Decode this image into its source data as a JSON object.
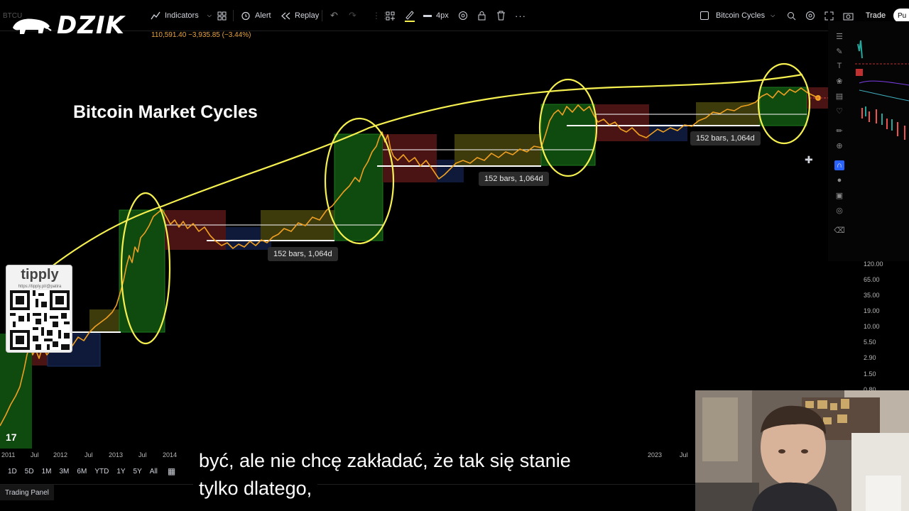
{
  "toolbar": {
    "brand": "DZIK",
    "indicators_label": "Indicators",
    "alert_label": "Alert",
    "replay_label": "Replay",
    "line_width_label": "4px",
    "layout_name": "Bitcoin Cycles",
    "trade_label": "Trade",
    "publish_label": "Pu"
  },
  "ticker": {
    "symbol": "BTCU",
    "price_info": "110,591.40  −3,935.85 (−3.44%)"
  },
  "chart": {
    "title": "Bitcoin Market Cycles",
    "measure_labels": [
      "152 bars, 1,064d",
      "152 bars, 1,064d",
      "152 bars, 1,064d"
    ],
    "price_ticks": [
      "120.00",
      "65.00",
      "35.00",
      "19.00",
      "10.00",
      "5.50",
      "2.90",
      "1.50",
      "0.80"
    ],
    "time_ticks": [
      "2011",
      "Jul",
      "2012",
      "Jul",
      "2013",
      "Jul",
      "2014",
      "2023",
      "Jul"
    ],
    "colors": {
      "price_line": "#f0a020",
      "annotation": "#f5f050",
      "bull_box": "#0f4a0f",
      "top_box": "#4a1414",
      "bottom_box": "#0f1a3a",
      "accum_box": "#3d3a0c"
    }
  },
  "range_bar": {
    "buttons": [
      "1D",
      "5D",
      "1M",
      "3M",
      "6M",
      "YTD",
      "1Y",
      "5Y",
      "All"
    ]
  },
  "trading_panel": {
    "label": "Trading Panel"
  },
  "overlay": {
    "subtitle_line1": "być, ale nie chcę zakładać, że tak się stanie",
    "subtitle_line2": "tylko dlatego,",
    "tipply_logo": "tipply",
    "tipply_url": "https://tipply.pl/@patira",
    "tv_logo": "17"
  }
}
